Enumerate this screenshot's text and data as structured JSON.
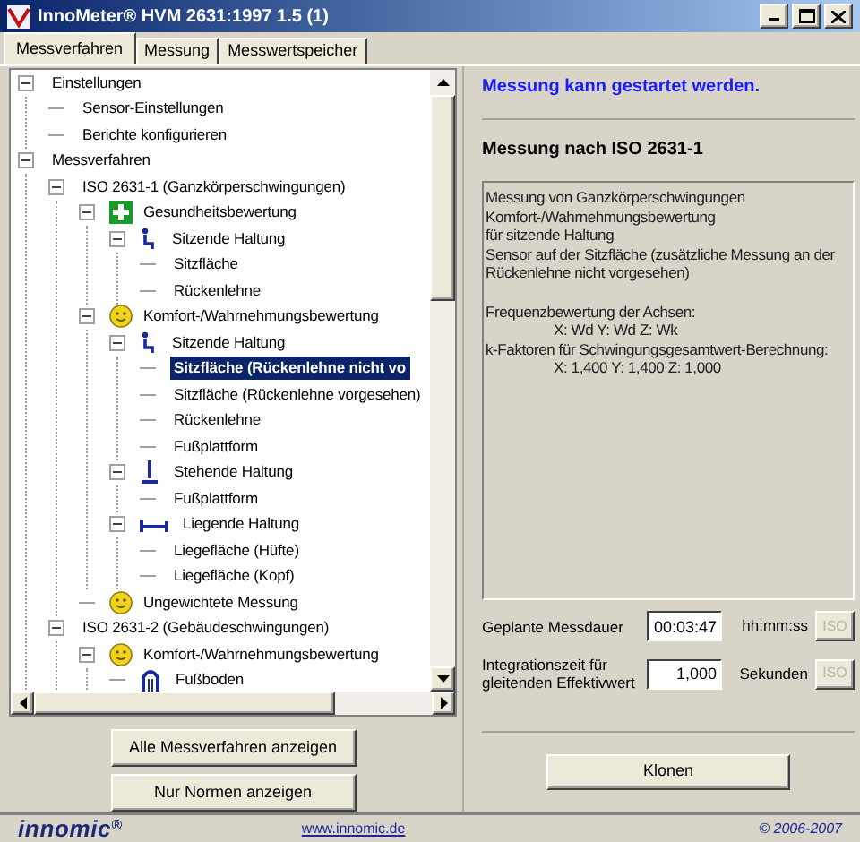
{
  "window": {
    "title": "InnoMeter® HVM 2631:1997 1.5 (1)"
  },
  "tabs": [
    {
      "label": "Messverfahren",
      "selected": true
    },
    {
      "label": "Messung",
      "selected": false
    },
    {
      "label": "Messwertspeicher",
      "selected": false
    }
  ],
  "tree": [
    {
      "label": "Einstellungen",
      "expanded": true,
      "selected": false,
      "children": [
        {
          "label": "Sensor-Einstellungen",
          "selected": false
        },
        {
          "label": "Berichte konfigurieren",
          "selected": false
        }
      ]
    },
    {
      "label": "Messverfahren",
      "expanded": true,
      "selected": false,
      "children": [
        {
          "label": "ISO 2631-1 (Ganzkörperschwingungen)",
          "expanded": true,
          "selected": false,
          "children": [
            {
              "label": "Gesundheitsbewertung",
              "kind": "cross",
              "expanded": true,
              "selected": false,
              "children": [
                {
                  "label": "Sitzende Haltung",
                  "kind": "sitting",
                  "expanded": true,
                  "selected": false,
                  "children": [
                    {
                      "label": "Sitzfläche",
                      "selected": false
                    },
                    {
                      "label": "Rückenlehne",
                      "selected": false
                    }
                  ]
                }
              ]
            },
            {
              "label": "Komfort-/Wahrnehmungsbewertung",
              "kind": "smiley",
              "expanded": true,
              "selected": false,
              "children": [
                {
                  "label": "Sitzende Haltung",
                  "kind": "sitting",
                  "expanded": true,
                  "selected": false,
                  "children": [
                    {
                      "label": "Sitzfläche (Rückenlehne nicht vo",
                      "selected": true
                    },
                    {
                      "label": "Sitzfläche (Rückenlehne vorgesehen)",
                      "selected": false
                    },
                    {
                      "label": "Rückenlehne",
                      "selected": false
                    },
                    {
                      "label": "Fußplattform",
                      "selected": false
                    }
                  ]
                },
                {
                  "label": "Stehende Haltung",
                  "kind": "standing",
                  "expanded": true,
                  "selected": false,
                  "children": [
                    {
                      "label": "Fußplattform",
                      "selected": false
                    }
                  ]
                },
                {
                  "label": "Liegende Haltung",
                  "kind": "lying",
                  "expanded": true,
                  "selected": false,
                  "children": [
                    {
                      "label": "Liegefläche (Hüfte)",
                      "selected": false
                    },
                    {
                      "label": "Liegefläche (Kopf)",
                      "selected": false
                    }
                  ]
                }
              ]
            },
            {
              "label": "Ungewichtete Messung",
              "kind": "smiley",
              "selected": false
            }
          ]
        },
        {
          "label": "ISO 2631-2 (Gebäudeschwingungen)",
          "expanded": true,
          "selected": false,
          "children": [
            {
              "label": "Komfort-/Wahrnehmungsbewertung",
              "kind": "smiley",
              "expanded": true,
              "selected": false,
              "children": [
                {
                  "label": "Fußboden",
                  "kind": "arch",
                  "selected": false
                }
              ]
            }
          ]
        }
      ]
    }
  ],
  "left_buttons": [
    "Alle Messverfahren anzeigen",
    "Nur Normen anzeigen"
  ],
  "status": "Messung kann gestartet werden.",
  "heading": "Messung nach ISO 2631-1",
  "description": [
    {
      "text": "Messung von Ganzkörperschwingungen",
      "kind": "plain"
    },
    {
      "text": "Komfort-/Wahrnehmungsbewertung",
      "kind": "plain"
    },
    {
      "text": "für sitzende Haltung",
      "kind": "plain"
    },
    {
      "text": "Sensor auf der Sitzfläche (zusätzliche Messung an der Rückenlehne nicht vorgesehen)",
      "kind": "plain"
    },
    {
      "text": "Frequenzbewertung der Achsen:",
      "kind": "spaced"
    },
    {
      "text": "X: Wd     Y: Wd     Z: Wk",
      "kind": "indented"
    },
    {
      "text": "k-Faktoren für Schwingungsgesamtwert-Berechnung:",
      "kind": "plain"
    },
    {
      "text": "X: 1,400  Y: 1,400  Z: 1,000",
      "kind": "indented"
    }
  ],
  "fields": [
    {
      "label": "Geplante Messdauer",
      "value": "00:03:47",
      "unit": "hh:mm:ss",
      "button": "ISO"
    },
    {
      "label": "Integrationszeit für gleitenden Effektivwert",
      "value": "1,000",
      "unit": "Sekunden",
      "button": "ISO"
    }
  ],
  "clone_button": "Klonen",
  "footer": {
    "logo": "innomic",
    "logo_mark": "®",
    "link": "www.innomic.de",
    "copyright": "© 2006-2007"
  }
}
